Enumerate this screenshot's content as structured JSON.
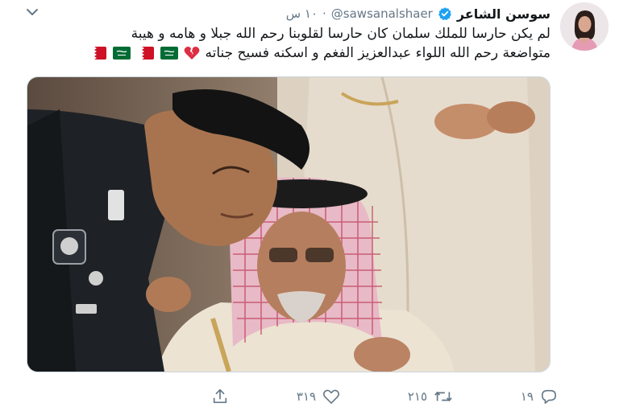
{
  "tweet": {
    "author_name": "سوسن الشاعر",
    "author_handle": "@sawsanalshaer",
    "separator": "·",
    "time": "١٠ س",
    "text_line1": "لم يكن حارسا للملك سلمان كان حارسا لقلوبنا رحم الله جبلا و هامه و هيبة",
    "text_line2": "متواضعة رحم الله اللواء عبدالعزيز الفغم و اسكنه فسيح جناته",
    "emojis": [
      "broken-heart",
      "flag-saudi-arabia",
      "flag-bahrain",
      "flag-saudi-arabia",
      "flag-bahrain"
    ]
  },
  "actions": {
    "replies": "١٩",
    "retweets": "٢١٥",
    "likes": "٣١٩"
  },
  "colors": {
    "text": "#14171a",
    "secondary": "#657786",
    "verified": "#1da1f2",
    "border": "#ccd6dd"
  },
  "icons": [
    "chevron-down-icon",
    "verified-badge-icon",
    "reply-icon",
    "retweet-icon",
    "like-icon",
    "share-icon"
  ]
}
